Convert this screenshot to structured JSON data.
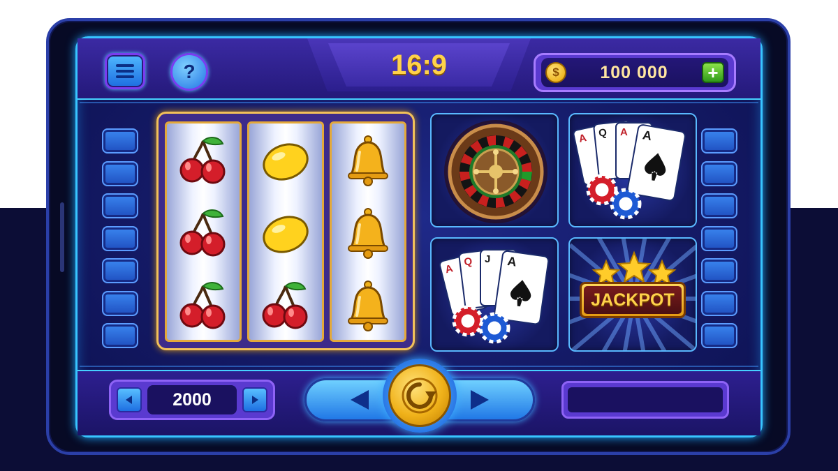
{
  "header": {
    "title": "16:9",
    "balance": "100 000",
    "coin_symbol": "$",
    "plus_label": "+",
    "help_label": "?"
  },
  "reels": {
    "columns": [
      [
        "cherry",
        "cherry",
        "cherry"
      ],
      [
        "lemon",
        "lemon",
        "cherry"
      ],
      [
        "bell",
        "bell",
        "bell"
      ]
    ]
  },
  "games": [
    {
      "name": "roulette-icon"
    },
    {
      "name": "playing-cards-icon"
    },
    {
      "name": "playing-cards-icon"
    },
    {
      "name": "jackpot-icon",
      "sign_text": "JACKPOT"
    }
  ],
  "footer": {
    "bet_value": "2000",
    "message": ""
  },
  "colors": {
    "accent_cyan": "#38c4ff",
    "gold": "#f2c15a",
    "purple": "#5a3ad0",
    "background": "#141a66"
  }
}
